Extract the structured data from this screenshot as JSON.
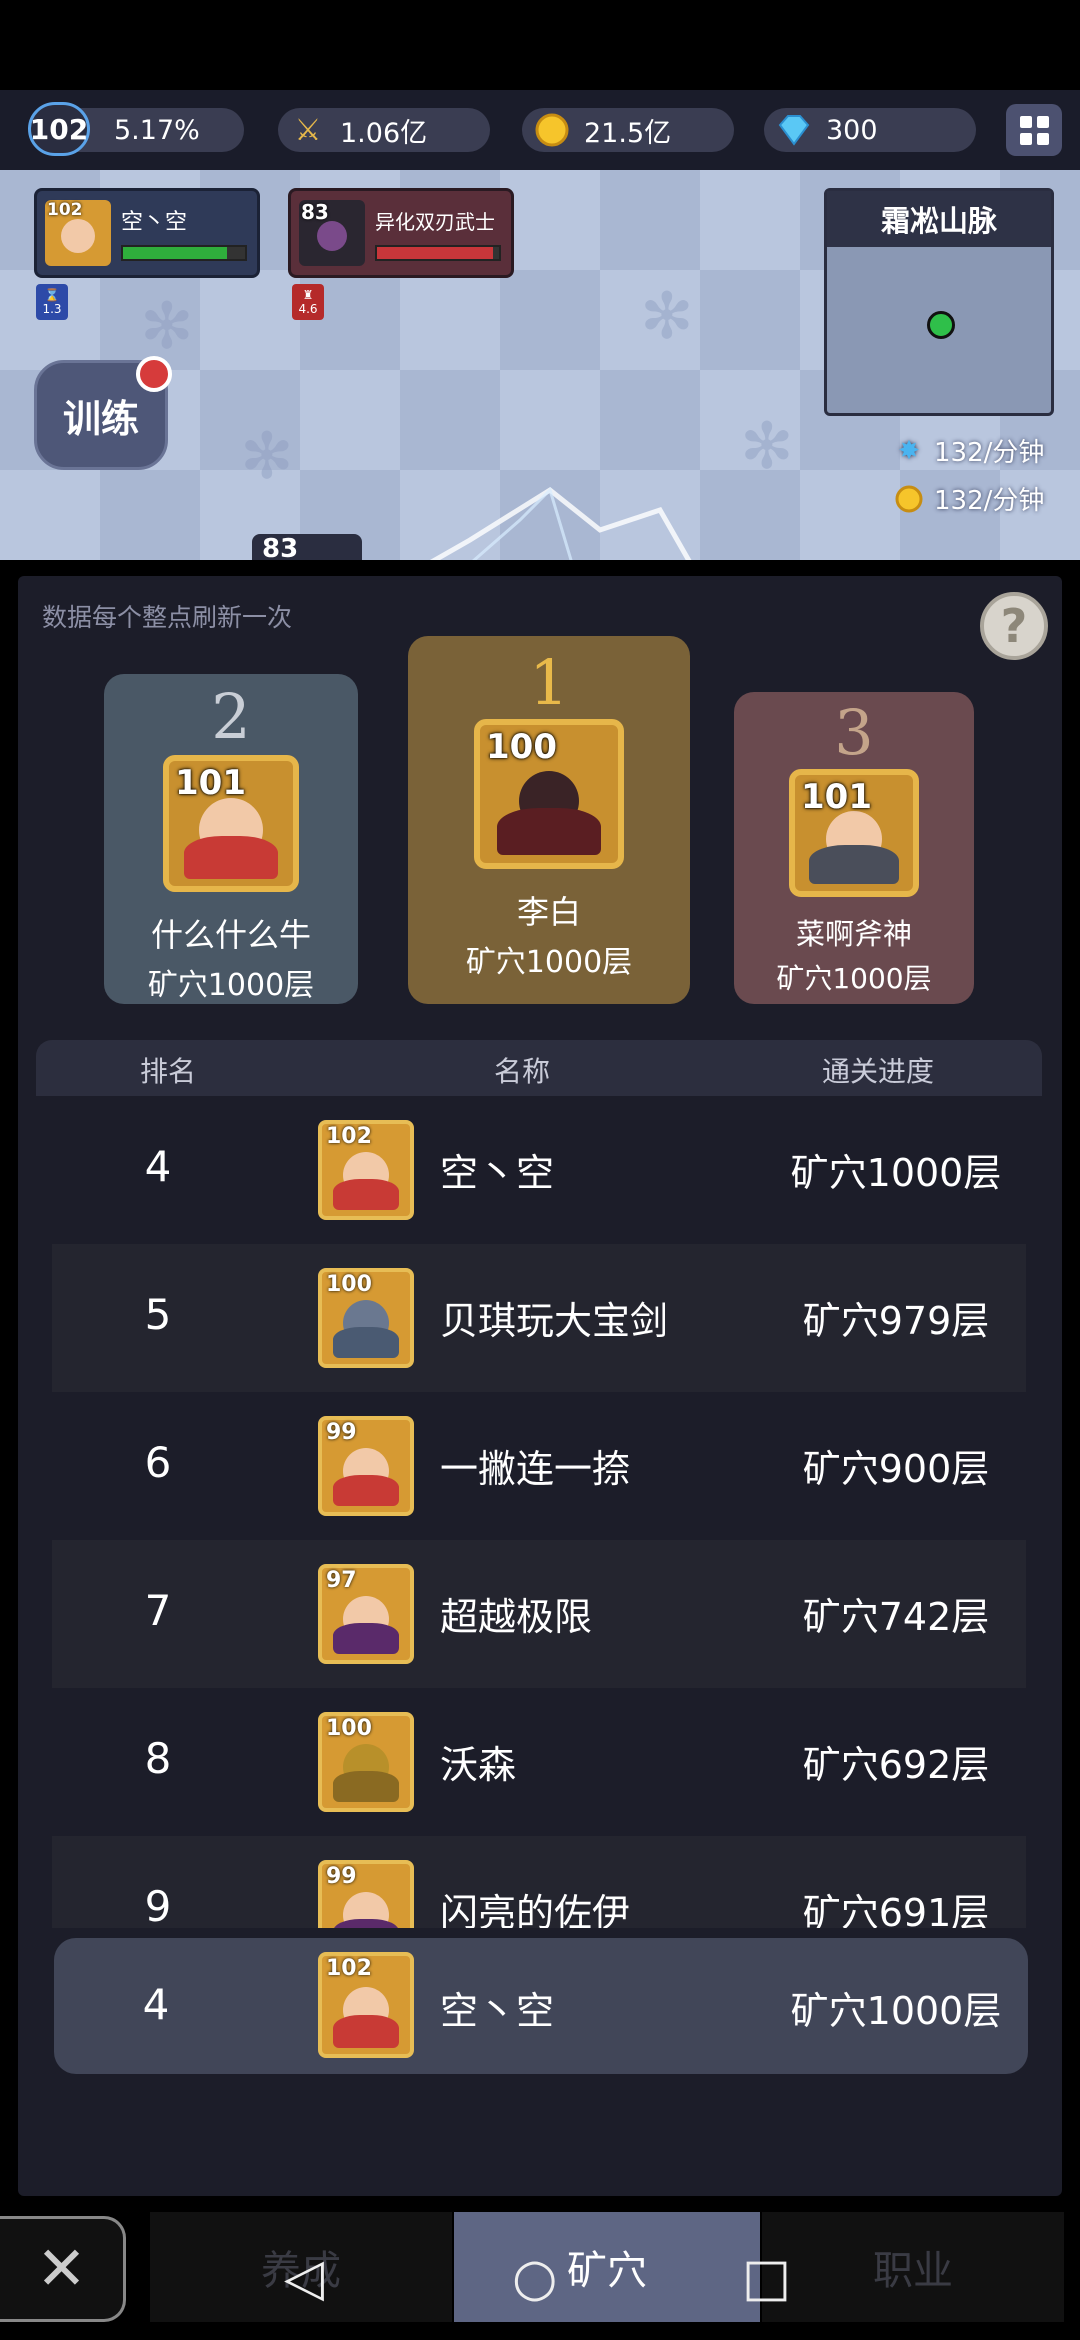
{
  "resources": {
    "level": "102",
    "exp_percent": "5.17%",
    "power": "1.06亿",
    "gold": "21.5亿",
    "diamonds": "300"
  },
  "battle": {
    "player": {
      "level": "102",
      "name": "空丶空",
      "hp_fraction": 0.85,
      "hp_color": "#2fae3c",
      "sub_icon_label": "1.3"
    },
    "enemy": {
      "level": "83",
      "name": "异化双刃武士",
      "hp_fraction": 0.95,
      "hp_color": "#c8363a",
      "sub_icon_label": "4.6"
    },
    "train_label": "训练",
    "map_name": "霜凇山脉",
    "exp_rate": "132/分钟",
    "gold_rate": "132/分钟",
    "bottom_label": "83"
  },
  "leaderboard": {
    "refresh_note": "数据每个整点刷新一次",
    "help_label": "?",
    "podium": [
      {
        "rank": "1",
        "level": "100",
        "name": "李白",
        "progress": "矿穴1000层",
        "bg": "#7a6238",
        "rank_color": "#e8b94a"
      },
      {
        "rank": "2",
        "level": "101",
        "name": "什么什么牛",
        "progress": "矿穴1000层",
        "bg": "#4a5866",
        "rank_color": "#c9ced6"
      },
      {
        "rank": "3",
        "level": "101",
        "name": "菜啊斧神",
        "progress": "矿穴1000层",
        "bg": "#6a4a4f",
        "rank_color": "#c4a48a"
      }
    ],
    "columns": {
      "rank": "排名",
      "name": "名称",
      "progress": "通关进度"
    },
    "rows": [
      {
        "rank": "4",
        "level": "102",
        "name": "空丶空",
        "progress": "矿穴1000层"
      },
      {
        "rank": "5",
        "level": "100",
        "name": "贝琪玩大宝剑",
        "progress": "矿穴979层"
      },
      {
        "rank": "6",
        "level": "99",
        "name": "一撇连一捺",
        "progress": "矿穴900层"
      },
      {
        "rank": "7",
        "level": "97",
        "name": "超越极限",
        "progress": "矿穴742层"
      },
      {
        "rank": "8",
        "level": "100",
        "name": "沃森",
        "progress": "矿穴692层"
      },
      {
        "rank": "9",
        "level": "99",
        "name": "闪亮的佐伊",
        "progress": "矿穴691层"
      }
    ],
    "self": {
      "rank": "4",
      "level": "102",
      "name": "空丶空",
      "progress": "矿穴1000层"
    }
  },
  "tabs": [
    {
      "label": "养成",
      "active": false
    },
    {
      "label": "矿穴",
      "active": true
    },
    {
      "label": "职业",
      "active": false
    }
  ],
  "icons": {
    "close": "close-icon",
    "back": "back-triangle-icon",
    "home": "home-circle-icon",
    "recents": "recents-square-icon"
  }
}
